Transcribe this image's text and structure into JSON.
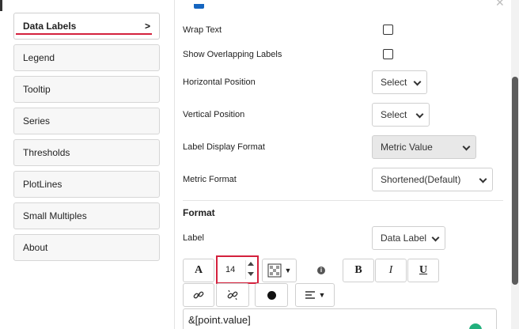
{
  "nav": {
    "items": [
      {
        "label": "Data Labels",
        "chevron": ">",
        "active": true
      },
      {
        "label": "Legend"
      },
      {
        "label": "Tooltip"
      },
      {
        "label": "Series"
      },
      {
        "label": "Thresholds"
      },
      {
        "label": "PlotLines"
      },
      {
        "label": "Small Multiples"
      },
      {
        "label": "About"
      }
    ]
  },
  "settings": {
    "wrap_text": {
      "label": "Wrap Text",
      "checked": false
    },
    "show_overlapping": {
      "label": "Show Overlapping Labels",
      "checked": false
    },
    "horizontal_position": {
      "label": "Horizontal Position",
      "value": "Select"
    },
    "vertical_position": {
      "label": "Vertical Position",
      "value": "Select"
    },
    "label_display_format": {
      "label": "Label Display Format",
      "value": "Metric Value"
    },
    "metric_format": {
      "label": "Metric Format",
      "value": "Shortened(Default)"
    }
  },
  "format": {
    "title": "Format",
    "label_field": {
      "label": "Label",
      "value": "Data Label"
    },
    "font_size": "14",
    "text_value": "&[point.value]",
    "buttons": {
      "font_a": "A",
      "bold": "B",
      "italic": "I",
      "underline": "U"
    }
  },
  "icons": {
    "close": "close-icon",
    "info": "info-icon",
    "link": "link-icon",
    "unlink": "unlink-icon",
    "color": "color-dot-icon",
    "align": "align-icon",
    "pattern": "fill-pattern-icon"
  },
  "colors": {
    "accent": "#d4213d",
    "thumb": "#5c5c5c",
    "green": "#22b07d",
    "blue": "#1565c0"
  }
}
